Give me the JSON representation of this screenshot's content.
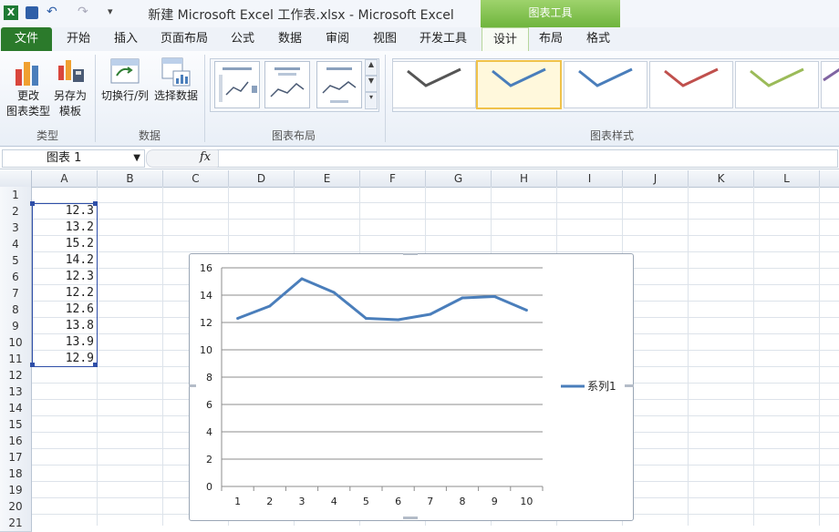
{
  "window": {
    "title": "新建 Microsoft Excel 工作表.xlsx  -  Microsoft Excel",
    "context_tab_group": "图表工具"
  },
  "tabs": [
    "文件",
    "开始",
    "插入",
    "页面布局",
    "公式",
    "数据",
    "审阅",
    "视图",
    "开发工具",
    "设计",
    "布局",
    "格式"
  ],
  "active_tab": "设计",
  "ribbon": {
    "groups": {
      "type": "类型",
      "data": "数据",
      "layout": "图表布局",
      "styles": "图表样式"
    },
    "buttons": {
      "change_type_1": "更改",
      "change_type_2": "图表类型",
      "save_template_1": "另存为",
      "save_template_2": "模板",
      "switch_row_col": "切换行/列",
      "select_data": "选择数据"
    },
    "style_colors": [
      "#555555",
      "#4a7ebb",
      "#4a7ebb",
      "#c0504d",
      "#9bbb59",
      "#8064a2"
    ],
    "selected_style_index": 1
  },
  "formula_bar": {
    "name_box": "图表 1",
    "fx": "fx",
    "formula": ""
  },
  "sheet": {
    "columns": [
      "A",
      "B",
      "C",
      "D",
      "E",
      "F",
      "G",
      "H",
      "I",
      "J",
      "K",
      "L"
    ],
    "rows": [
      "1",
      "2",
      "3",
      "4",
      "5",
      "6",
      "7",
      "8",
      "9",
      "10",
      "11",
      "12",
      "13",
      "14",
      "15",
      "16",
      "17",
      "18",
      "19",
      "20",
      "21"
    ],
    "column_a_values": [
      "",
      "12.3",
      "13.2",
      "15.2",
      "14.2",
      "12.3",
      "12.2",
      "12.6",
      "13.8",
      "13.9",
      "12.9"
    ]
  },
  "chart_data": {
    "type": "line",
    "x": [
      1,
      2,
      3,
      4,
      5,
      6,
      7,
      8,
      9,
      10
    ],
    "series": [
      {
        "name": "系列1",
        "values": [
          12.3,
          13.2,
          15.2,
          14.2,
          12.3,
          12.2,
          12.6,
          13.8,
          13.9,
          12.9
        ],
        "color": "#4a7ebb"
      }
    ],
    "ylim": [
      0,
      16
    ],
    "yticks": [
      0,
      2,
      4,
      6,
      8,
      10,
      12,
      14,
      16
    ],
    "grid": true,
    "legend": "right"
  }
}
